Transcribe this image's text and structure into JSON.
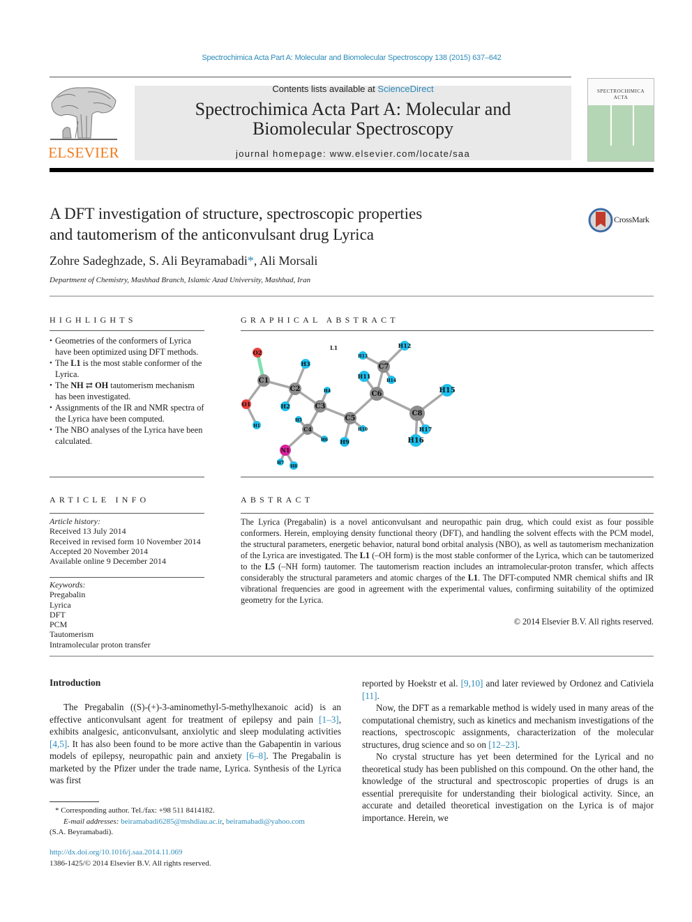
{
  "running_head": "Spectrochimica Acta Part A: Molecular and Biomolecular Spectroscopy 138 (2015) 637–642",
  "masthead": {
    "contents_prefix": "Contents lists available at ",
    "contents_link": "ScienceDirect",
    "journal_title_line1": "Spectrochimica Acta Part A: Molecular and",
    "journal_title_line2": "Biomolecular Spectroscopy",
    "homepage": "journal homepage: www.elsevier.com/locate/saa",
    "publisher_logo": "ELSEVIER",
    "cover_title_line1": "SPECTROCHIMICA",
    "cover_title_line2": "ACTA"
  },
  "colors": {
    "link": "#2a8ab8",
    "elsevier_orange": "#f07b1e",
    "cover_green": "#b5d6b5",
    "masthead_bg": "#e9e9e9"
  },
  "article": {
    "title_line1": "A DFT investigation of structure, spectroscopic properties",
    "title_line2": "and tautomerism of the anticonvulsant drug Lyrica",
    "crossmark_label": "CrossMark",
    "authors": [
      {
        "name": "Zohre Sadeghzade",
        "sep": ", "
      },
      {
        "name": "S. Ali Beyramabadi",
        "mark": "*",
        "sep": ", "
      },
      {
        "name": "Ali Morsali",
        "sep": ""
      }
    ],
    "affiliation": "Department of Chemistry, Mashhad Branch, Islamic Azad University, Mashhad, Iran"
  },
  "highlights": {
    "heading": "HIGHLIGHTS",
    "items": [
      {
        "pre": "Geometries of the conformers of Lyrica have been optimized using DFT methods.",
        "bold": "",
        "post": ""
      },
      {
        "pre": "The ",
        "bold": "L1",
        "post": " is the most stable conformer of the Lyrica."
      },
      {
        "pre": "The ",
        "bold": "NH ⇄ OH",
        "post": " tautomerism mechanism has been investigated."
      },
      {
        "pre": "Assignments of the IR and NMR spectra of the Lyrica have been computed.",
        "bold": "",
        "post": ""
      },
      {
        "pre": "The NBO analyses of the Lyrica have been calculated.",
        "bold": "",
        "post": ""
      }
    ]
  },
  "graphical_abstract": {
    "heading": "GRAPHICAL ABSTRACT",
    "figure_label": "L1",
    "atoms": [
      {
        "id": "O2",
        "el": "O"
      },
      {
        "id": "C1",
        "el": "C"
      },
      {
        "id": "O1",
        "el": "O"
      },
      {
        "id": "H1",
        "el": "H"
      },
      {
        "id": "C2",
        "el": "C"
      },
      {
        "id": "H3",
        "el": "H"
      },
      {
        "id": "H2",
        "el": "H"
      },
      {
        "id": "C3",
        "el": "C"
      },
      {
        "id": "H4",
        "el": "H"
      },
      {
        "id": "C4",
        "el": "C"
      },
      {
        "id": "H5",
        "el": "H"
      },
      {
        "id": "H6",
        "el": "H"
      },
      {
        "id": "N1",
        "el": "N"
      },
      {
        "id": "H7",
        "el": "H"
      },
      {
        "id": "H8",
        "el": "H"
      },
      {
        "id": "C5",
        "el": "C"
      },
      {
        "id": "H9",
        "el": "H"
      },
      {
        "id": "H10",
        "el": "H"
      },
      {
        "id": "C6",
        "el": "C"
      },
      {
        "id": "H11",
        "el": "H"
      },
      {
        "id": "C7",
        "el": "C"
      },
      {
        "id": "H12",
        "el": "H"
      },
      {
        "id": "H13",
        "el": "H"
      },
      {
        "id": "H14",
        "el": "H"
      },
      {
        "id": "C8",
        "el": "C"
      },
      {
        "id": "H15",
        "el": "H"
      },
      {
        "id": "H16",
        "el": "H"
      },
      {
        "id": "H17",
        "el": "H"
      }
    ],
    "element_colors": {
      "C": "#8c8c8c",
      "H": "#1ec0ee",
      "O": "#e8413f",
      "N": "#d6209a",
      "double_bond": "#7fe0b0"
    }
  },
  "article_info": {
    "heading": "ARTICLE INFO",
    "history_label": "Article history:",
    "history": [
      "Received 13 July 2014",
      "Received in revised form 10 November 2014",
      "Accepted 20 November 2014",
      "Available online 9 December 2014"
    ],
    "keywords_label": "Keywords:",
    "keywords": [
      "Pregabalin",
      "Lyrica",
      "DFT",
      "PCM",
      "Tautomerism",
      "Intramolecular proton transfer"
    ]
  },
  "abstract": {
    "heading": "ABSTRACT",
    "p1": "The Lyrica (Pregabalin) is a novel anticonvulsant and neuropathic pain drug, which could exist as four possible conformers. Herein, employing density functional theory (DFT), and handling the solvent effects with the PCM model, the structural parameters, energetic behavior, natural bond orbital analysis (NBO), as well as tautomerism mechanization of the Lyrica are investigated. The ",
    "b1": "L1",
    "p2": " (–OH form) is the most stable conformer of the Lyrica, which can be tautomerized to the ",
    "b2": "L5",
    "p3": " (–NH form) tautomer. The tautomerism reaction includes an intramolecular-proton transfer, which affects considerably the structural parameters and atomic charges of the ",
    "b3": "L1",
    "p4": ". The DFT-computed NMR chemical shifts and IR vibrational frequencies are good in agreement with the experimental values, confirming suitability of the optimized geometry for the Lyrica.",
    "copyright": "© 2014 Elsevier B.V. All rights reserved."
  },
  "introduction": {
    "heading": "Introduction",
    "left": {
      "t1": "The Pregabalin ((S)-(+)-3-aminomethyl-5-methylhexanoic acid) is an effective anticonvulsant agent for treatment of epilepsy and pain ",
      "r1": "[1–3]",
      "t2": ", exhibits analgesic, anticonvulsant, anxiolytic and sleep modulating activities ",
      "r2": "[4,5]",
      "t3": ". It has also been found to be more active than the Gabapentin in various models of epilepsy, neuropathic pain and anxiety ",
      "r3": "[6–8]",
      "t4": ". The Pregabalin is marketed by the Pfizer under the trade name, Lyrica. Synthesis of the Lyrica was first"
    },
    "right": {
      "a1": "reported by Hoekstr et al. ",
      "ar1": "[9,10]",
      "a2": " and later reviewed by Ordonez and Cativiela ",
      "ar2": "[11]",
      "a3": ".",
      "b1": "Now, the DFT as a remarkable method is widely used in many areas of the computational chemistry, such as kinetics and mechanism investigations of the reactions, spectroscopic assignments, characterization of the molecular structures, drug science and so on ",
      "br1": "[12–23]",
      "b2": ".",
      "c1": "No crystal structure has yet been determined for the Lyrical and no theoretical study has been published on this compound. On the other hand, the knowledge of the structural and spectroscopic properties of drugs is an essential prerequisite for understanding their biological activity. Since, an accurate and detailed theoretical investigation on the Lyrica is of major importance. Herein, we"
    }
  },
  "footnotes": {
    "corresponding": "* Corresponding author. Tel./fax: +98 511 8414182.",
    "email_label": "E-mail addresses:",
    "email1": "beiramabadi6285@mshdiau.ac.ir",
    "email2": "beiramabadi@yahoo.com",
    "email_owner": "(S.A. Beyramabadi)."
  },
  "footer": {
    "doi": "http://dx.doi.org/10.1016/j.saa.2014.11.069",
    "issn_copyright": "1386-1425/© 2014 Elsevier B.V. All rights reserved."
  }
}
